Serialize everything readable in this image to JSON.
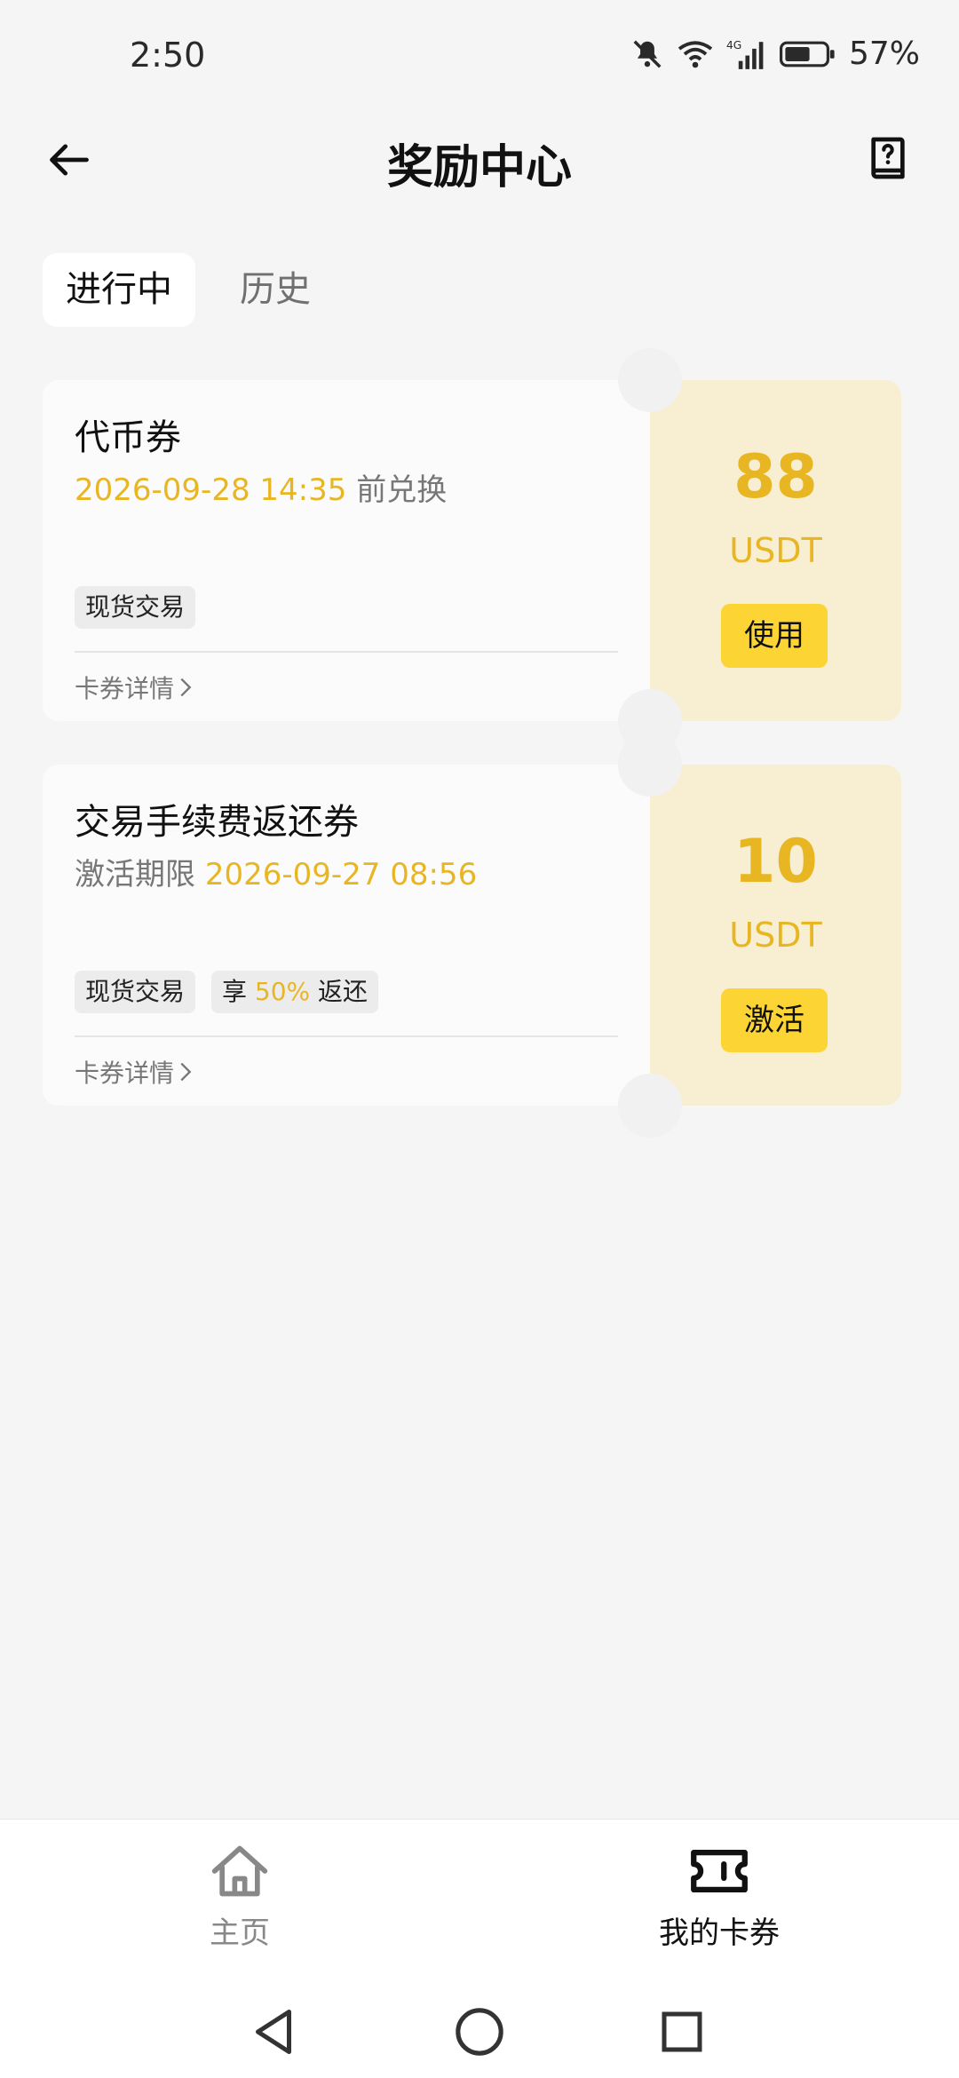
{
  "status_bar": {
    "time": "2:50",
    "network": "4G",
    "battery": "57%"
  },
  "header": {
    "title": "奖励中心",
    "back_icon": "arrow-left-icon",
    "help_icon": "help-book-icon"
  },
  "tabs": [
    {
      "label": "进行中",
      "active": true
    },
    {
      "label": "历史",
      "active": false
    }
  ],
  "coupons": [
    {
      "title": "代币券",
      "subtitle_prefix": "",
      "subtitle_date": "2026-09-28 14:35",
      "subtitle_suffix": " 前兑换",
      "tags": [
        {
          "text": "现货交易"
        }
      ],
      "details_label": "卡券详情",
      "amount": "88",
      "unit": "USDT",
      "action_label": "使用"
    },
    {
      "title": "交易手续费返还券",
      "subtitle_prefix": "激活期限 ",
      "subtitle_date": "2026-09-27 08:56",
      "subtitle_suffix": "",
      "tags": [
        {
          "text": "现货交易"
        },
        {
          "text_prefix": "享 ",
          "highlight": "50%",
          "text_suffix": " 返还"
        }
      ],
      "details_label": "卡券详情",
      "amount": "10",
      "unit": "USDT",
      "action_label": "激活"
    }
  ],
  "bottom_nav": [
    {
      "label": "主页",
      "icon": "home-icon",
      "active": false
    },
    {
      "label": "我的卡券",
      "icon": "ticket-icon",
      "active": true
    }
  ],
  "colors": {
    "accent": "#fcd535",
    "highlight_text": "#e9b623",
    "coupon_side": "#f8efd2",
    "background": "#f5f5f5"
  }
}
